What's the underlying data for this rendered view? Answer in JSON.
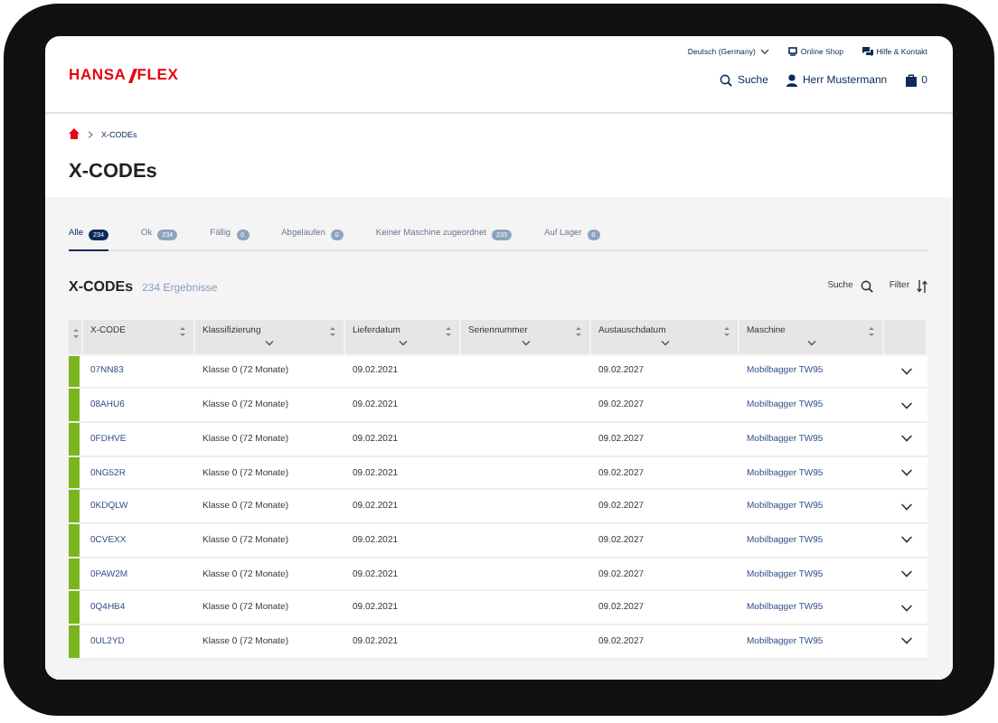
{
  "header": {
    "logo_left": "HANSA",
    "logo_right": "FLEX",
    "language": "Deutsch (Germany)",
    "online_shop": "Online Shop",
    "help": "Hilfe & Kontakt",
    "search": "Suche",
    "user": "Herr Mustermann",
    "cart_count": "0"
  },
  "breadcrumb": [
    "X-CODEs"
  ],
  "page_title": "X-CODEs",
  "tabs": [
    {
      "label": "Alle",
      "count": "234",
      "selected": true
    },
    {
      "label": "Ok",
      "count": "234",
      "selected": false
    },
    {
      "label": "Fällig",
      "count": "0",
      "selected": false
    },
    {
      "label": "Abgelaufen",
      "count": "0",
      "selected": false
    },
    {
      "label": "Keiner Maschine zugeordnet",
      "count": "233",
      "selected": false
    },
    {
      "label": "Auf Lager",
      "count": "0",
      "selected": false
    }
  ],
  "section": {
    "title": "X-CODEs",
    "results": "234 Ergebnisse",
    "search": "Suche",
    "filter": "Filter"
  },
  "table": {
    "columns": [
      {
        "label": "X-CODE",
        "filter": false
      },
      {
        "label": "Klassifizierung",
        "filter": true
      },
      {
        "label": "Lieferdatum",
        "filter": true
      },
      {
        "label": "Seriennummer",
        "filter": true
      },
      {
        "label": "Austauschdatum",
        "filter": true
      },
      {
        "label": "Maschine",
        "filter": true
      }
    ],
    "rows": [
      {
        "color": "#7ab51d",
        "x_code": "07NN83",
        "klassifizierung": "Klasse 0 (72 Monate)",
        "lieferdatum": "09.02.2021",
        "austauschdatum": "09.02.2027",
        "maschine": "Mobilbagger TW95"
      },
      {
        "color": "#7ab51d",
        "x_code": "08AHU6",
        "klassifizierung": "Klasse 0 (72 Monate)",
        "lieferdatum": "09.02.2021",
        "austauschdatum": "09.02.2027",
        "maschine": "Mobilbagger TW95"
      },
      {
        "color": "#7ab51d",
        "x_code": "0FDHVE",
        "klassifizierung": "Klasse 0 (72 Monate)",
        "lieferdatum": "09.02.2021",
        "austauschdatum": "09.02.2027",
        "maschine": "Mobilbagger TW95"
      },
      {
        "color": "#7ab51d",
        "x_code": "0NG52R",
        "klassifizierung": "Klasse 0 (72 Monate)",
        "lieferdatum": "09.02.2021",
        "austauschdatum": "09.02.2027",
        "maschine": "Mobilbagger TW95"
      },
      {
        "color": "#7ab51d",
        "x_code": "0KDQLW",
        "klassifizierung": "Klasse 0 (72 Monate)",
        "lieferdatum": "09.02.2021",
        "austauschdatum": "09.02.2027",
        "maschine": "Mobilbagger TW95"
      },
      {
        "color": "#7ab51d",
        "x_code": "0CVEXX",
        "klassifizierung": "Klasse 0 (72 Monate)",
        "lieferdatum": "09.02.2021",
        "austauschdatum": "09.02.2027",
        "maschine": "Mobilbagger TW95"
      },
      {
        "color": "#7ab51d",
        "x_code": "0PAW2M",
        "klassifizierung": "Klasse 0 (72 Monate)",
        "lieferdatum": "09.02.2021",
        "austauschdatum": "09.02.2027",
        "maschine": "Mobilbagger TW95"
      },
      {
        "color": "#7ab51d",
        "x_code": "0Q4HB4",
        "klassifizierung": "Klasse 0 (72 Monate)",
        "lieferdatum": "09.02.2021",
        "austauschdatum": "09.02.2027",
        "maschine": "Mobilbagger TW95"
      },
      {
        "color": "#7ab51d",
        "x_code": "0UL2YD",
        "klassifizierung": "Klasse 0 (72 Monate)",
        "lieferdatum": "09.02.2021",
        "austauschdatum": "09.02.2027",
        "maschine": "Mobilbagger TW95"
      }
    ]
  }
}
